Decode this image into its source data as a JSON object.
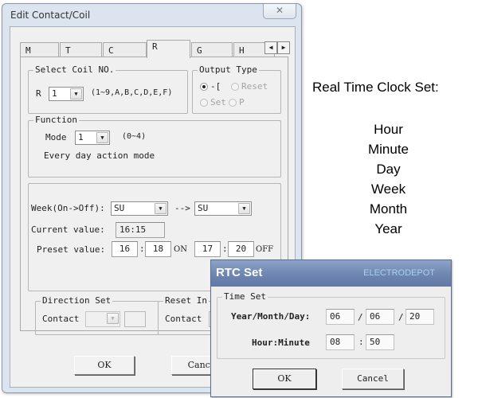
{
  "main_window": {
    "title": "Edit Contact/Coil",
    "close_glyph": "✕",
    "tabs": [
      {
        "label": "M",
        "active": false
      },
      {
        "label": "T",
        "active": false
      },
      {
        "label": "C",
        "active": false
      },
      {
        "label": "R",
        "active": true
      },
      {
        "label": "G",
        "active": false
      },
      {
        "label": "H",
        "active": false
      }
    ],
    "tab_scroll": {
      "left_glyph": "◀",
      "right_glyph": "▶"
    },
    "select_coil": {
      "group_label": "Select Coil NO.",
      "prefix": "R",
      "value": "1",
      "range_hint": "(1~9,A,B,C,D,E,F)"
    },
    "output_type": {
      "group_label": "Output Type",
      "options": [
        {
          "label": "-[",
          "checked": true,
          "enabled": true
        },
        {
          "label": "Reset",
          "checked": false,
          "enabled": false
        },
        {
          "label": "Set",
          "checked": false,
          "enabled": false
        },
        {
          "label": "P",
          "checked": false,
          "enabled": false
        }
      ]
    },
    "function": {
      "group_label": "Function",
      "mode_label": "Mode",
      "mode_value": "1",
      "mode_range": "(0~4)",
      "description": "Every day action mode"
    },
    "schedule": {
      "week_label": "Week(On->Off):",
      "week_on": "SU",
      "arrow": "-->",
      "week_off": "SU",
      "current_label": "Current value:",
      "current_value": "16:15",
      "preset_label": "Preset value:",
      "on_hour": "16",
      "on_minute": "18",
      "on_label": "ON",
      "off_hour": "17",
      "off_minute": "20",
      "off_label": "OFF",
      "separator": ":"
    },
    "direction_set": {
      "group_label": "Direction Set",
      "contact_label": "Contact"
    },
    "reset_input": {
      "group_label": "Reset In",
      "contact_label": "Contact"
    },
    "buttons": {
      "ok": "OK",
      "cancel": "Cance"
    }
  },
  "rtc_dialog": {
    "title": "RTC Set",
    "brand": "ELECTRODEPOT",
    "group_label": "Time Set",
    "date_label": "Year/Month/Day:",
    "year": "06",
    "month": "06",
    "day": "20",
    "date_separator": "/",
    "time_label": "Hour:Minute",
    "hour": "08",
    "minute": "50",
    "time_separator": ":",
    "ok": "OK",
    "cancel": "Cancel"
  },
  "annotation": {
    "title": "Real Time Clock Set:",
    "items": [
      "Hour",
      "Minute",
      "Day",
      "Week",
      "Month",
      "Year"
    ]
  }
}
